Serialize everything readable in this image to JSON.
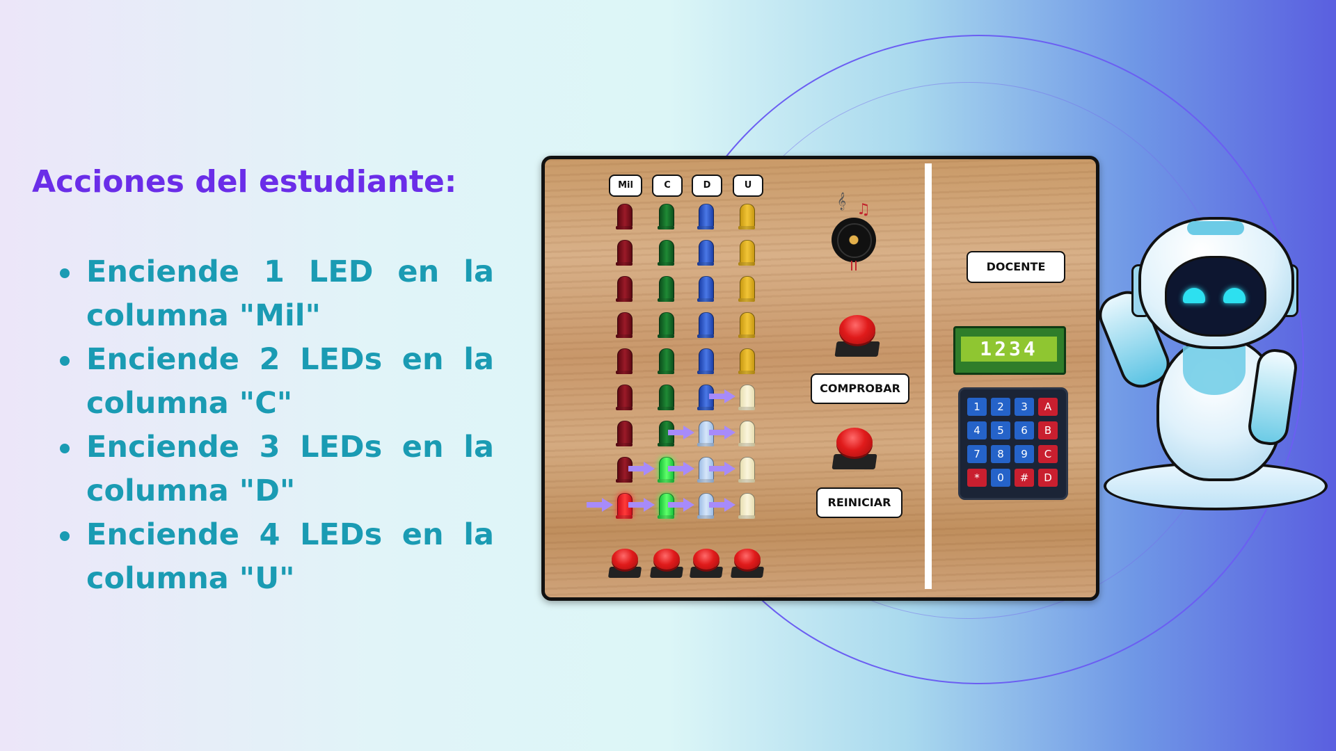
{
  "heading": "Acciones del estudiante:",
  "actions": [
    {
      "line1": [
        "Enciende",
        "1",
        "LED",
        "en",
        "la"
      ],
      "line2": "columna \"Mil\""
    },
    {
      "line1": [
        "Enciende",
        "2",
        "LEDs",
        "en",
        "la"
      ],
      "line2": "columna \"C\""
    },
    {
      "line1": [
        "Enciende",
        "3",
        "LEDs",
        "en",
        "la"
      ],
      "line2": "columna \"D\""
    },
    {
      "line1": [
        "Enciende",
        "4",
        "LEDs",
        "en",
        "la"
      ],
      "line2": "columna \"U\""
    }
  ],
  "board": {
    "columns": [
      {
        "label": "Mil",
        "color": "red",
        "lit": 1
      },
      {
        "label": "C",
        "color": "green",
        "lit": 2
      },
      {
        "label": "D",
        "color": "blue",
        "lit": 3
      },
      {
        "label": "U",
        "color": "yellow",
        "lit": 4
      }
    ],
    "rows_per_column": 9,
    "teacher_label": "DOCENTE",
    "check_label": "COMPROBAR",
    "reset_label": "REINICIAR",
    "lcd_text": "1234",
    "keypad": [
      [
        "1",
        "2",
        "3",
        "A"
      ],
      [
        "4",
        "5",
        "6",
        "B"
      ],
      [
        "7",
        "8",
        "9",
        "C"
      ],
      [
        "*",
        "0",
        "#",
        "D"
      ]
    ]
  },
  "colors": {
    "heading": "#6a2de8",
    "action_text": "#1a9bb3",
    "arrow": "#a78bfa",
    "button_red": "#e01b1b"
  },
  "icons": [
    "buzzer-icon",
    "music-note-icon",
    "robot-mascot"
  ]
}
